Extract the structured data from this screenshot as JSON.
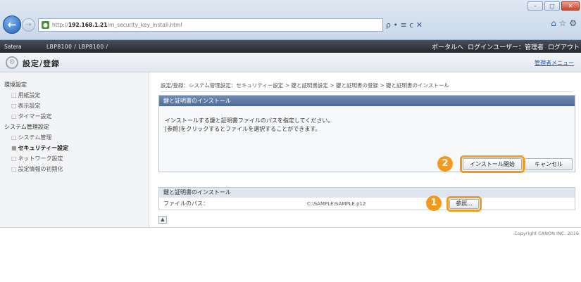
{
  "browser": {
    "url_prefix": "http://",
    "url_host": "192.168.1.21",
    "url_path": "/m_security_key_install.html",
    "win_min": "–",
    "win_max": "□",
    "win_close": "✕",
    "addr_tools": "ρ • ≡ c ✕",
    "tab_icons": "⌂ ☆ ⚙"
  },
  "device": {
    "brand": "Satera",
    "model": "LBP8100 / LBP8100 /",
    "portal_link": "ポータルへ",
    "login_user": "ログインユーザー：管理者",
    "logout": "ログアウト"
  },
  "page": {
    "title": "設定/登録",
    "portal_link": "管理者メニュー"
  },
  "sidebar": {
    "group1": "環境設定",
    "group1_items": [
      "用紙設定",
      "表示設定",
      "タイマー設定"
    ],
    "group2": "システム管理設定",
    "group2_items": [
      "システム管理",
      "セキュリティー設定",
      "ネットワーク設定",
      "設定情報の初期化"
    ]
  },
  "breadcrumb": "設定/登録：システム管理設定：セキュリティー設定 > 鍵と証明書設定 > 鍵と証明書の登録 > 鍵と証明書のインストール",
  "panel": {
    "title": "鍵と証明書のインストール",
    "line1": "インストールする鍵と証明書ファイルのパスを指定してください。",
    "line2": "[参照]をクリックするとファイルを選択することができます。",
    "install_button": "インストール開始",
    "cancel_button": "キャンセル"
  },
  "section": {
    "title": "鍵と証明書のインストール",
    "path_label": "ファイルのパス：",
    "path_value": "C:\\SAMPLE\\SAMPLE.p12",
    "browse_button": "参照..."
  },
  "steps": {
    "one": "1",
    "two": "2"
  },
  "top_link": "▲",
  "footer": {
    "copyright": "Copyright CANON INC. 2016"
  },
  "colors": {
    "highlight": "#f39a1e",
    "panel_title": "#4e6b96"
  }
}
